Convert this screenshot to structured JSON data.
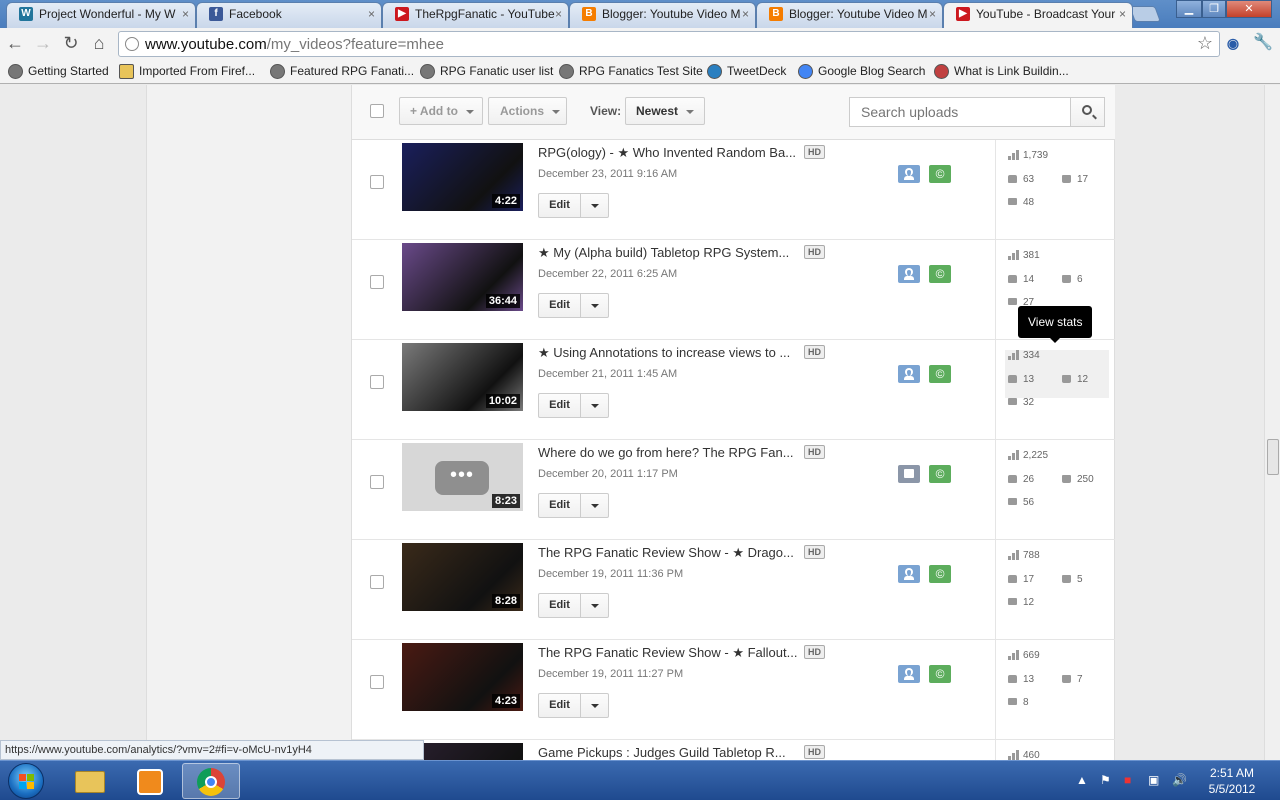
{
  "browser": {
    "tabs": [
      {
        "title": "Project Wonderful - My W",
        "icon": "wordpress-icon",
        "color": "#21759b",
        "letter": "W"
      },
      {
        "title": "Facebook",
        "icon": "facebook-icon",
        "color": "#3b5998",
        "letter": "f"
      },
      {
        "title": "TheRpgFanatic - YouTube",
        "icon": "youtube-icon",
        "color": "#cc181e",
        "letter": "▶"
      },
      {
        "title": "Blogger: Youtube Video M",
        "icon": "blogger-icon",
        "color": "#f57d00",
        "letter": "B"
      },
      {
        "title": "Blogger: Youtube Video M",
        "icon": "blogger-icon",
        "color": "#f57d00",
        "letter": "B"
      },
      {
        "title": "YouTube - Broadcast Your",
        "icon": "youtube-icon",
        "color": "#cc181e",
        "letter": "▶"
      }
    ],
    "url_host": "www.youtube.com",
    "url_path": "/my_videos?feature=mhee",
    "bookmarks": [
      "Getting Started",
      "Imported From Firef...",
      "Featured RPG Fanati...",
      "RPG Fanatic user list",
      "RPG Fanatics Test Site",
      "TweetDeck",
      "Google Blog Search",
      "What is Link Buildin..."
    ],
    "status_url": "https://www.youtube.com/analytics/?vmv=2#fi=v-oMcU-nv1yH4"
  },
  "toolbar": {
    "add_to_label": "Add to",
    "actions_label": "Actions",
    "view_label": "View:",
    "view_value": "Newest",
    "search_placeholder": "Search uploads"
  },
  "tooltip": "View stats",
  "videos": [
    {
      "title": "RPG(ology) - ★ Who Invented Random Ba...",
      "date": "December 23, 2011 9:16 AM",
      "duration": "4:22",
      "views": "1,739",
      "likes": "63",
      "dislikes": "17",
      "comments": "48",
      "privacy": "public",
      "thumb_color": "#1a1f5c"
    },
    {
      "title": "★ My (Alpha build) Tabletop RPG System...",
      "date": "December 22, 2011 6:25 AM",
      "duration": "36:44",
      "views": "381",
      "likes": "14",
      "dislikes": "6",
      "comments": "27",
      "privacy": "public",
      "thumb_color": "#6a4a8a"
    },
    {
      "title": "★ Using Annotations to increase views to ...",
      "date": "December 21, 2011 1:45 AM",
      "duration": "10:02",
      "views": "334",
      "likes": "13",
      "dislikes": "12",
      "comments": "32",
      "privacy": "public",
      "thumb_color": "#7a7a7a"
    },
    {
      "title": "Where do we go from here? The RPG Fan...",
      "date": "December 20, 2011 1:17 PM",
      "duration": "8:23",
      "views": "2,225",
      "likes": "26",
      "dislikes": "250",
      "comments": "56",
      "privacy": "private",
      "thumb_color": "#d7d7d7"
    },
    {
      "title": "The RPG Fanatic Review Show - ★ Drago...",
      "date": "December 19, 2011 11:36 PM",
      "duration": "8:28",
      "views": "788",
      "likes": "17",
      "dislikes": "5",
      "comments": "12",
      "privacy": "public",
      "thumb_color": "#3a2a1a"
    },
    {
      "title": "The RPG Fanatic Review Show - ★ Fallout...",
      "date": "December 19, 2011 11:27 PM",
      "duration": "4:23",
      "views": "669",
      "likes": "13",
      "dislikes": "7",
      "comments": "8",
      "privacy": "public",
      "thumb_color": "#4a1a12"
    },
    {
      "title": "Game Pickups : Judges Guild Tabletop R...",
      "date": "",
      "duration": "",
      "views": "460",
      "likes": "",
      "dislikes": "",
      "comments": "",
      "privacy": "",
      "thumb_color": "#2a2030"
    }
  ],
  "row_labels": {
    "edit": "Edit",
    "hd": "HD",
    "copyright": "©"
  },
  "taskbar": {
    "time": "2:51 AM",
    "date": "5/5/2012"
  }
}
